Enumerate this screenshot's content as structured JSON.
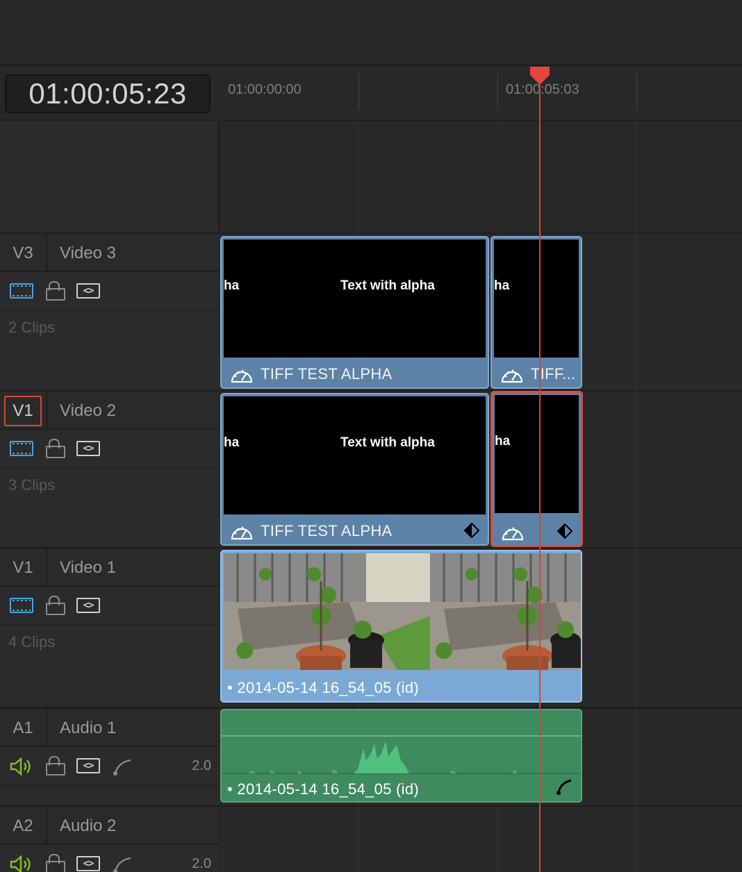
{
  "timecode": "01:00:05:23",
  "ruler": {
    "labels": [
      "01:00:00:00",
      "01:00:05:03"
    ]
  },
  "tracks": [
    {
      "id": "V3",
      "name": "Video 3",
      "clips": "2 Clips",
      "selected": false
    },
    {
      "id": "V1",
      "name": "Video 2",
      "clips": "3 Clips",
      "selected": true
    },
    {
      "id": "V1",
      "name": "Video 1",
      "clips": "4 Clips",
      "selected": false
    },
    {
      "id": "A1",
      "name": "Audio 1",
      "volume": "2.0"
    },
    {
      "id": "A2",
      "name": "Audio 2",
      "volume": "2.0"
    }
  ],
  "clips": {
    "v3_main": {
      "label": "TIFF TEST ALPHA",
      "overlay": "Text with alpha",
      "overlay_left": "ha"
    },
    "v3_short": {
      "label": "TIFF...",
      "overlay_left": "ha"
    },
    "v2_main": {
      "label": "TIFF TEST ALPHA",
      "overlay": "Text with alpha",
      "overlay_left": "ha"
    },
    "v2_short": {
      "overlay_left": "ha"
    },
    "v1_main": {
      "label": "• 2014-05-14 16_54_05 (id)"
    },
    "a1_main": {
      "label": "• 2014-05-14 16_54_05 (id)"
    }
  },
  "icons": {
    "film": "video-track-icon",
    "lock": "lock-icon",
    "code": "auto-select-icon",
    "speaker": "speaker-icon",
    "curve": "curve-icon",
    "gauge": "retime-speed-icon",
    "keyframe": "keyframe-icon"
  },
  "colors": {
    "playhead": "#d84434",
    "video_clip": "#5c82a8",
    "video1_clip": "#7aa9d6",
    "audio_clip": "#3f8a5f",
    "selection": "#e14a3a",
    "track_icon": "#4aa3df",
    "audio_icon": "#8dbb2e"
  }
}
